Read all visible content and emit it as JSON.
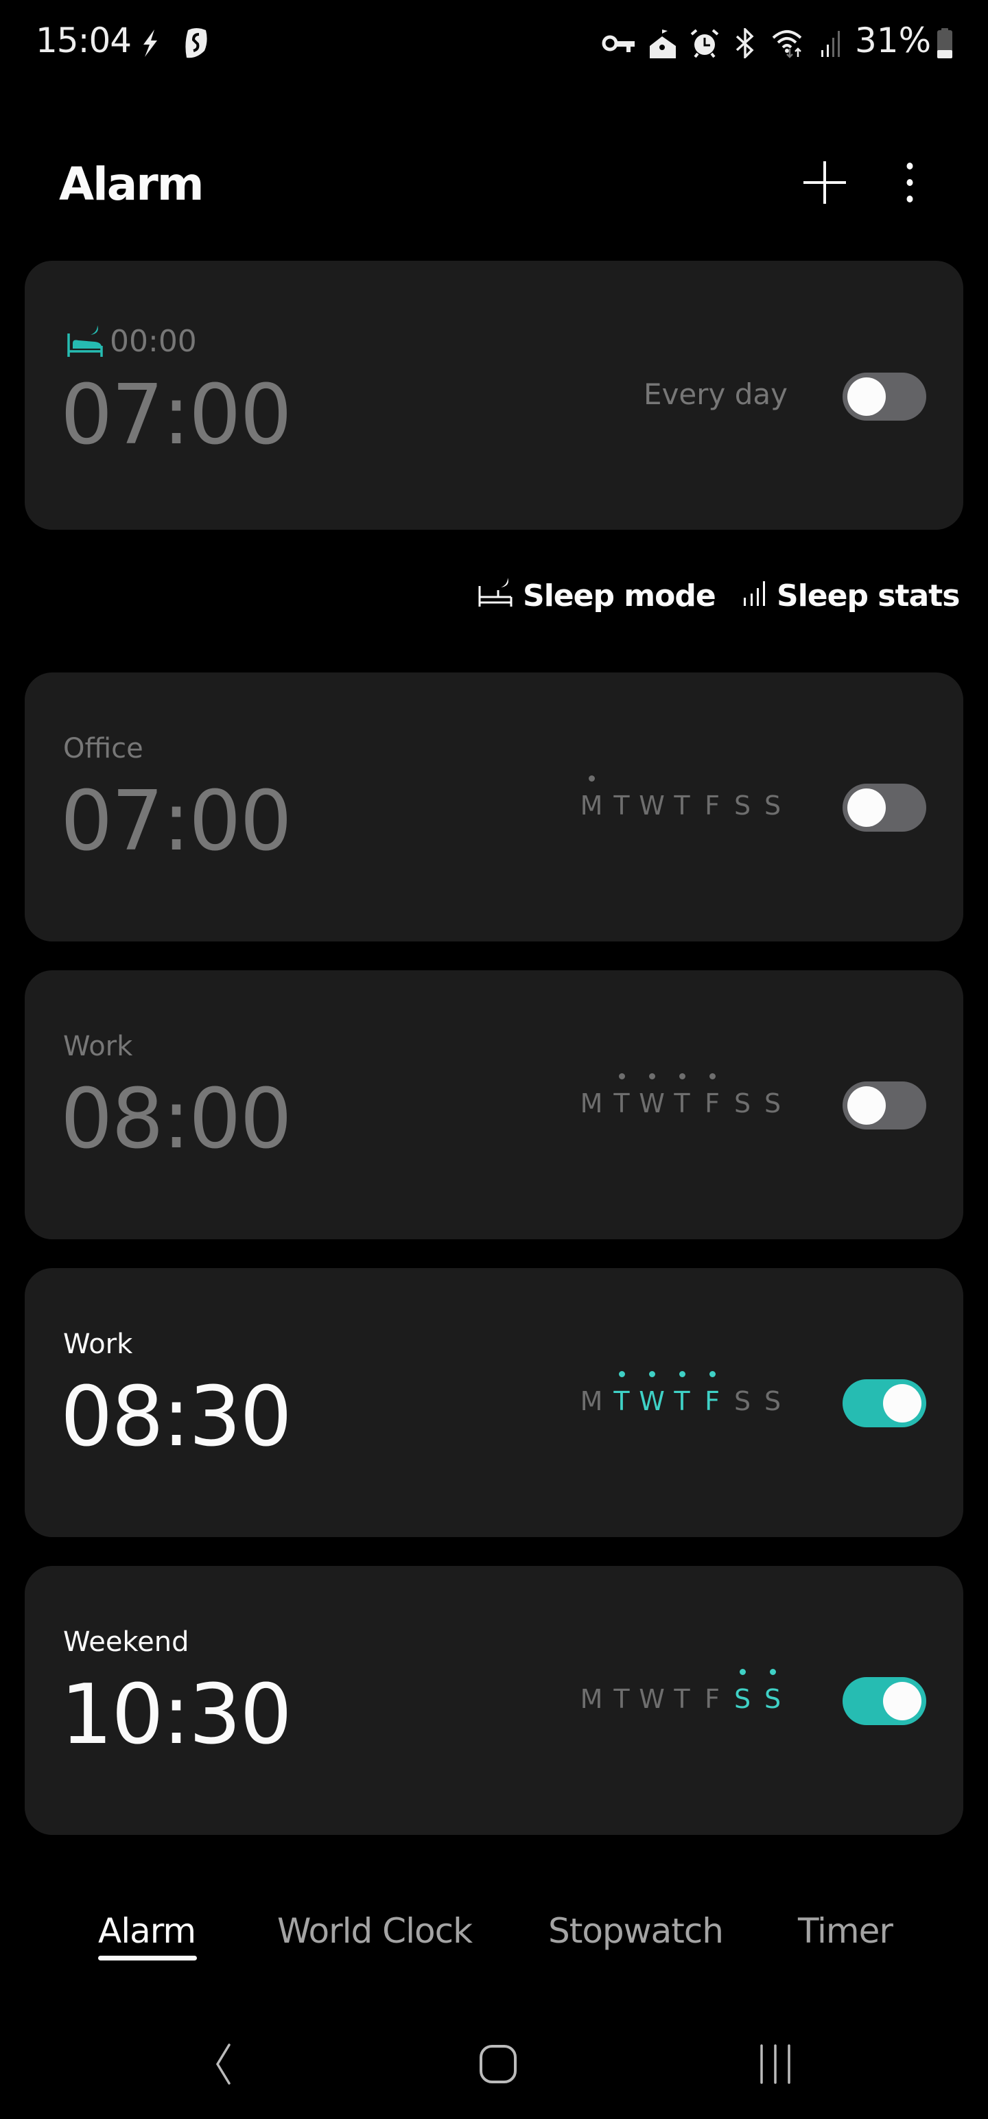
{
  "status_bar": {
    "time": "15:04",
    "battery_percent": "31%",
    "left_icons": [
      "flash-icon",
      "surfshark-vpn-icon"
    ],
    "right_icons": [
      "vpn-key-icon",
      "home-notification-icon",
      "alarm-icon",
      "bluetooth-icon",
      "wifi-icon",
      "signal-icon",
      "battery-icon"
    ]
  },
  "header": {
    "title": "Alarm",
    "add_icon": "plus-icon",
    "more_icon": "more-vert-icon"
  },
  "bedtime_card": {
    "bedtime": "00:00",
    "wake_time": "07:00",
    "repeat": "Every day",
    "enabled": false
  },
  "sleep_links": {
    "sleep_mode": "Sleep mode",
    "sleep_stats": "Sleep stats"
  },
  "alarms": [
    {
      "label": "Office",
      "time": "07:00",
      "enabled": false,
      "days": [
        {
          "letter": "M",
          "selected": true
        },
        {
          "letter": "T",
          "selected": false
        },
        {
          "letter": "W",
          "selected": false
        },
        {
          "letter": "T",
          "selected": false
        },
        {
          "letter": "F",
          "selected": false
        },
        {
          "letter": "S",
          "selected": false
        },
        {
          "letter": "S",
          "selected": false
        }
      ]
    },
    {
      "label": "Work",
      "time": "08:00",
      "enabled": false,
      "days": [
        {
          "letter": "M",
          "selected": false
        },
        {
          "letter": "T",
          "selected": true
        },
        {
          "letter": "W",
          "selected": true
        },
        {
          "letter": "T",
          "selected": true
        },
        {
          "letter": "F",
          "selected": true
        },
        {
          "letter": "S",
          "selected": false
        },
        {
          "letter": "S",
          "selected": false
        }
      ]
    },
    {
      "label": "Work",
      "time": "08:30",
      "enabled": true,
      "days": [
        {
          "letter": "M",
          "selected": false
        },
        {
          "letter": "T",
          "selected": true
        },
        {
          "letter": "W",
          "selected": true
        },
        {
          "letter": "T",
          "selected": true
        },
        {
          "letter": "F",
          "selected": true
        },
        {
          "letter": "S",
          "selected": false
        },
        {
          "letter": "S",
          "selected": false
        }
      ]
    },
    {
      "label": "Weekend",
      "time": "10:30",
      "enabled": true,
      "days": [
        {
          "letter": "M",
          "selected": false
        },
        {
          "letter": "T",
          "selected": false
        },
        {
          "letter": "W",
          "selected": false
        },
        {
          "letter": "T",
          "selected": false
        },
        {
          "letter": "F",
          "selected": false
        },
        {
          "letter": "S",
          "selected": true
        },
        {
          "letter": "S",
          "selected": true
        }
      ]
    }
  ],
  "tabs": [
    {
      "label": "Alarm",
      "active": true
    },
    {
      "label": "World Clock",
      "active": false
    },
    {
      "label": "Stopwatch",
      "active": false
    },
    {
      "label": "Timer",
      "active": false
    }
  ],
  "nav_bar": [
    "back-icon",
    "home-icon",
    "recents-icon"
  ],
  "colors": {
    "accent": "#26bcb2",
    "accent_text": "#3fd1c6",
    "card_bg": "#1c1c1c",
    "toggle_off": "#636366",
    "dim_text": "#777777",
    "background": "#000000"
  }
}
